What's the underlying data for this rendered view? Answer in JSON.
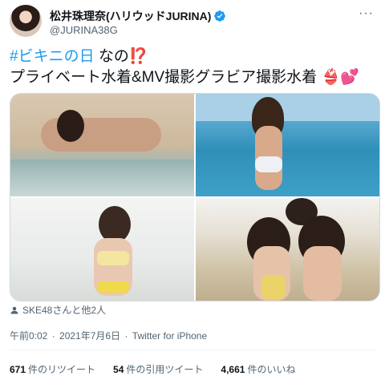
{
  "author": {
    "display_name": "松井珠理奈(ハリウッドJURINA)",
    "handle": "@JURINA38G",
    "verified_icon": "verified-badge-icon",
    "more_icon": "more-dots-icon"
  },
  "tweet": {
    "hashtag": "#ビキニの日",
    "line1_rest": " なの",
    "line1_emoji": "⁉️",
    "line2": "プライベート水着&MV撮影グラビア撮影水着",
    "line2_emoji_bikini": "👙",
    "line2_emoji_hearts": "💕"
  },
  "media": {
    "photos": [
      "photo-1",
      "photo-2",
      "photo-3",
      "photo-4"
    ]
  },
  "engagers": {
    "text": "SKE48さんと他2人",
    "icon": "person-icon"
  },
  "meta": {
    "time": "午前0:02",
    "separator": "·",
    "date": "2021年7月6日",
    "source": "Twitter for iPhone"
  },
  "stats": {
    "retweets_count": "671",
    "retweets_label": "件のリツイート",
    "quotes_count": "54",
    "quotes_label": "件の引用ツイート",
    "likes_count": "4,661",
    "likes_label": "件のいいね"
  },
  "colors": {
    "accent": "#1d9bf0",
    "text_primary": "#0f1419",
    "text_secondary": "#536471"
  }
}
